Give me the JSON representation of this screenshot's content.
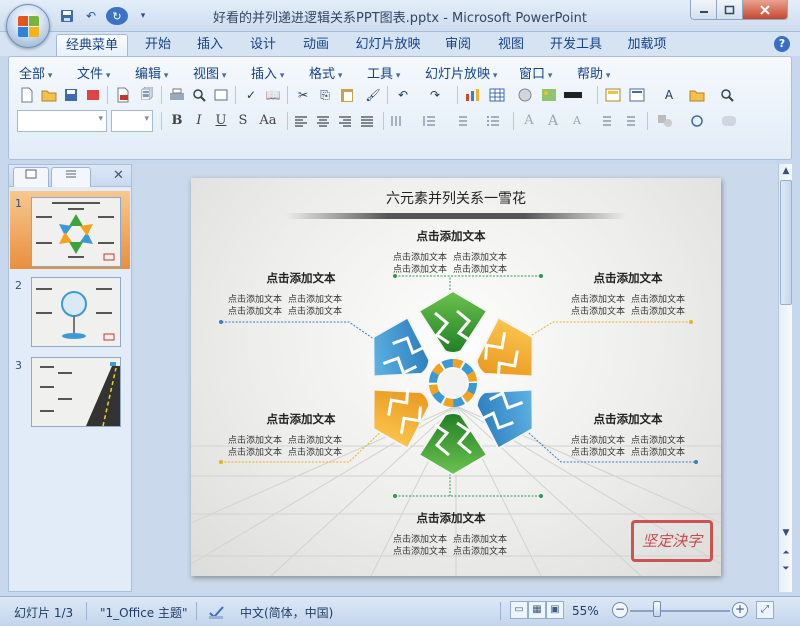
{
  "window": {
    "title": "好看的并列递进逻辑关系PPT图表.pptx - Microsoft PowerPoint"
  },
  "tabs": [
    {
      "label": "经典菜单",
      "active": true
    },
    {
      "label": "开始"
    },
    {
      "label": "插入"
    },
    {
      "label": "设计"
    },
    {
      "label": "动画"
    },
    {
      "label": "幻灯片放映"
    },
    {
      "label": "审阅"
    },
    {
      "label": "视图"
    },
    {
      "label": "开发工具"
    },
    {
      "label": "加载项"
    }
  ],
  "menu": [
    "全部",
    "文件",
    "编辑",
    "视图",
    "插入",
    "格式",
    "工具",
    "幻灯片放映",
    "窗口",
    "帮助"
  ],
  "format_buttons": [
    "B",
    "I",
    "U",
    "S",
    "Aa"
  ],
  "slides_panel": {
    "numbers": [
      "1",
      "2",
      "3"
    ],
    "selected": 1
  },
  "slide": {
    "title": "六元素并列关系一雪花",
    "heading": "点击添加文本",
    "body_text": "点击添加文本",
    "seal_text": "坚定決字"
  },
  "status": {
    "slide_info": "幻灯片 1/3",
    "theme": "\"1_Office 主题\"",
    "language": "中文(简体，中国)",
    "zoom": "55%"
  },
  "colors": {
    "blue_petal": "#3a9ad6",
    "green_petal": "#3aa53a",
    "orange_petal": "#f2a21c",
    "accent_dot": "#2d9a52"
  }
}
